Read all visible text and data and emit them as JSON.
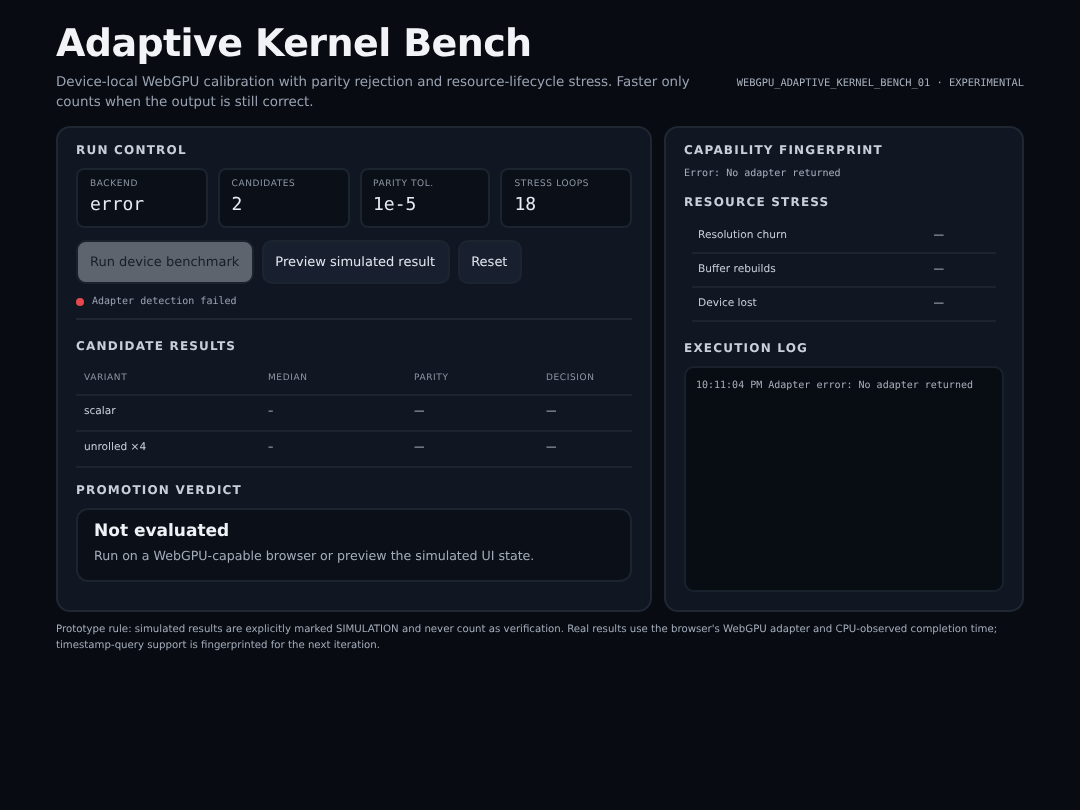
{
  "header": {
    "title": "Adaptive Kernel Bench",
    "subtitle": "Device-local WebGPU calibration with parity rejection and resource-lifecycle stress. Faster only counts when the output is still correct.",
    "tag": "WEBGPU_ADAPTIVE_KERNEL_BENCH_01 · EXPERIMENTAL"
  },
  "run_control": {
    "title": "RUN CONTROL",
    "stats": [
      {
        "label": "BACKEND",
        "value": "error"
      },
      {
        "label": "CANDIDATES",
        "value": "2"
      },
      {
        "label": "PARITY TOL.",
        "value": "1e-5"
      },
      {
        "label": "STRESS LOOPS",
        "value": "18"
      }
    ],
    "buttons": [
      {
        "label": "Run device benchmark",
        "kind": "primary",
        "disabled": true
      },
      {
        "label": "Preview simulated result",
        "kind": "secondary",
        "disabled": false
      },
      {
        "label": "Reset",
        "kind": "secondary",
        "disabled": false
      }
    ],
    "status": {
      "text": "Adapter detection failed",
      "color": "#e5484d"
    }
  },
  "candidate_results": {
    "title": "CANDIDATE RESULTS",
    "columns": [
      "VARIANT",
      "MEDIAN",
      "PARITY",
      "DECISION"
    ],
    "rows": [
      [
        "scalar",
        "–",
        "—",
        "—"
      ],
      [
        "unrolled ×4",
        "–",
        "—",
        "—"
      ]
    ]
  },
  "promotion_verdict": {
    "title": "PROMOTION VERDICT",
    "heading": "Not evaluated",
    "text": "Run on a WebGPU-capable browser or preview the simulated UI state."
  },
  "capability_fingerprint": {
    "title": "CAPABILITY FINGERPRINT",
    "text": "Error: No adapter returned"
  },
  "resource_stress": {
    "title": "RESOURCE STRESS",
    "rows": [
      {
        "label": "Resolution churn",
        "value": "—"
      },
      {
        "label": "Buffer rebuilds",
        "value": "—"
      },
      {
        "label": "Device lost",
        "value": "—"
      }
    ]
  },
  "execution_log": {
    "title": "EXECUTION LOG",
    "lines": [
      "10:11:04 PM Adapter error: No adapter returned"
    ]
  },
  "footnote": "Prototype rule: simulated results are explicitly marked SIMULATION and never count as verification. Real results use the browser's WebGPU adapter and CPU-observed completion time; timestamp-query support is fingerprinted for the next iteration."
}
